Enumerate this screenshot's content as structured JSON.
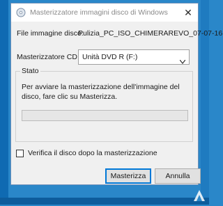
{
  "window": {
    "title": "Masterizzatore immagini disco di Windows",
    "close_symbol": "✕",
    "icon": "disc-burner-icon"
  },
  "form": {
    "file_label": "File immagine disco:",
    "file_value": "Pulizia_PC_ISO_CHIMERAREVO_07-07-16",
    "burner_label": "Masterizzatore CD:",
    "burner_selected": "Unità DVD R (F:)"
  },
  "status": {
    "group_label": "Stato",
    "message": "Per avviare la masterizzazione dell'immagine del disco, fare clic su Masterizza.",
    "progress_fraction": 0
  },
  "options": {
    "verify_label": "Verifica il disco dopo la masterizzazione",
    "verify_checked": false
  },
  "buttons": {
    "burn_label": "Masterizza",
    "cancel_label": "Annulla"
  },
  "colors": {
    "accent": "#0078d7",
    "desktop": "#2a87c9",
    "progress": "#06b025"
  }
}
